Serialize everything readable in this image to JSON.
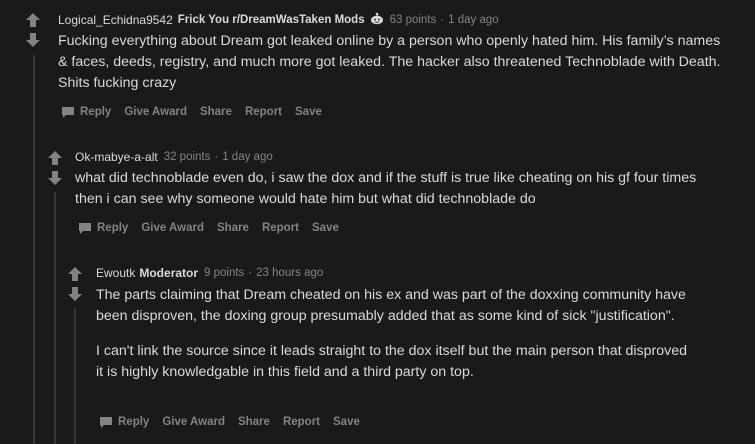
{
  "comments": [
    {
      "author": "Logical_Echidna9542",
      "flair": "Frick You r/DreamWasTaken Mods",
      "flair_icon": "snoo-icon",
      "points": "63 points",
      "separator": "·",
      "time": "1 day ago",
      "paragraphs": [
        "Fucking everything about Dream got leaked online by a person who openly hated him. His family’s names & faces, deeds, registry, and much more got leaked. The hacker also threatened Technoblade with Death. Shits fucking crazy"
      ]
    },
    {
      "author": "Ok-mabye-a-alt",
      "points": "32 points",
      "separator": "·",
      "time": "1 day ago",
      "paragraphs": [
        "what did technoblade even do, i saw the dox and if the stuff is true like cheating on his gf four times then i can see why someone would hate him but what did technoblade do"
      ]
    },
    {
      "author": "Ewoutk",
      "mod_label": "Moderator",
      "points": "9 points",
      "separator": "·",
      "time": "23 hours ago",
      "paragraphs": [
        "The parts claiming that Dream cheated on his ex and was part of the doxxing community have been disproven, the doxing group presumably added that as some kind of sick \"justification\".",
        "I can't link the source since it leads straight to the dox itself but the main person that disproved it is highly knowledgable in this field and a third party on top."
      ]
    }
  ],
  "actions": {
    "reply": "Reply",
    "give_award": "Give Award",
    "share": "Share",
    "report": "Report",
    "save": "Save"
  },
  "colors": {
    "background": "#1a1a1b",
    "text": "#d7dadc",
    "muted": "#818384",
    "thread_line": "#343536"
  },
  "icons": {
    "upvote": "upvote-arrow-icon",
    "downvote": "downvote-arrow-icon",
    "reply": "speech-bubble-icon"
  }
}
